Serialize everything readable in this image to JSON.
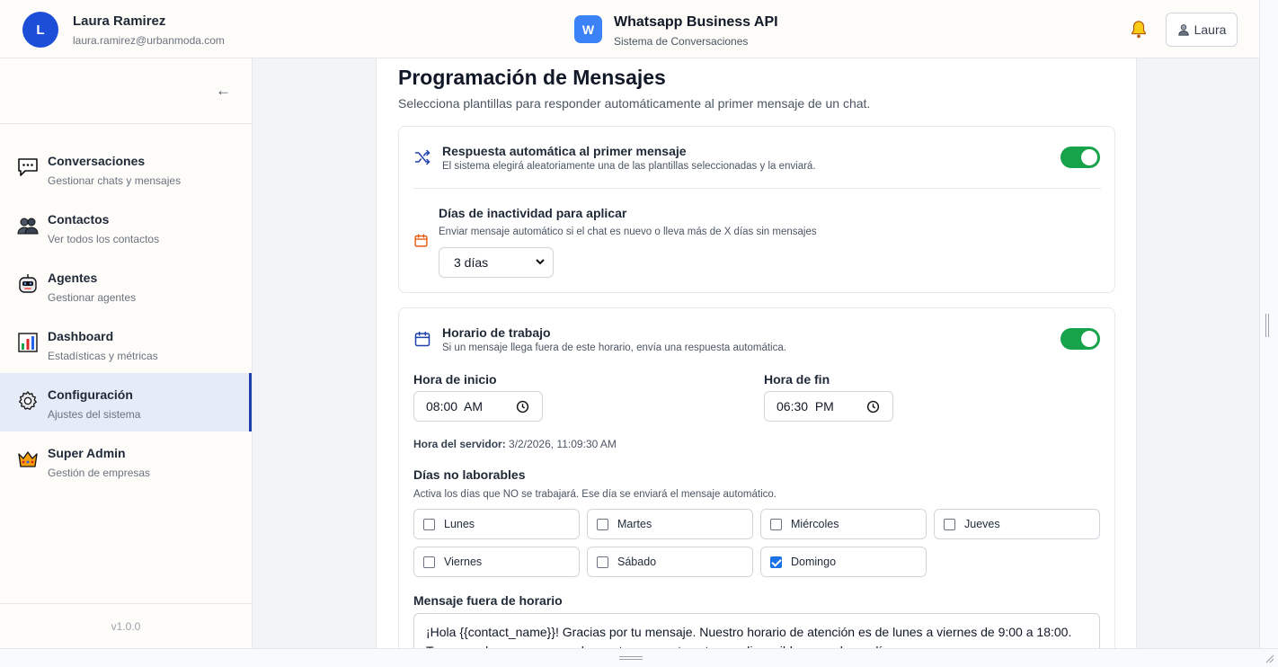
{
  "header": {
    "avatar_letter": "L",
    "user_name": "Laura Ramirez",
    "user_email": "laura.ramirez@urbanmoda.com",
    "app_logo_letter": "W",
    "app_title": "Whatsapp Business API",
    "app_subtitle": "Sistema de Conversaciones",
    "user_button_label": "Laura"
  },
  "sidebar": {
    "collapse_label": "←",
    "items": [
      {
        "title": "Conversaciones",
        "subtitle": "Gestionar chats y mensajes",
        "icon": "speech-bubble-icon"
      },
      {
        "title": "Contactos",
        "subtitle": "Ver todos los contactos",
        "icon": "people-icon"
      },
      {
        "title": "Agentes",
        "subtitle": "Gestionar agentes",
        "icon": "robot-icon"
      },
      {
        "title": "Dashboard",
        "subtitle": "Estadísticas y métricas",
        "icon": "bar-chart-icon"
      },
      {
        "title": "Configuración",
        "subtitle": "Ajustes del sistema",
        "icon": "gear-icon",
        "active": true
      },
      {
        "title": "Super Admin",
        "subtitle": "Gestión de empresas",
        "icon": "crown-icon"
      }
    ],
    "version": "v1.0.0"
  },
  "main": {
    "title": "Programación de Mensajes",
    "description": "Selecciona plantillas para responder automáticamente al primer mensaje de un chat.",
    "auto_reply": {
      "title": "Respuesta automática al primer mensaje",
      "subtitle": "El sistema elegirá aleatoriamente una de las plantillas seleccionadas y la enviará.",
      "enabled": true,
      "inactivity_title": "Días de inactividad para aplicar",
      "inactivity_subtitle": "Enviar mensaje automático si el chat es nuevo o lleva más de X días sin mensajes",
      "inactivity_value": "3 días"
    },
    "work_hours": {
      "title": "Horario de trabajo",
      "subtitle": "Si un mensaje llega fuera de este horario, envía una respuesta automática.",
      "enabled": true,
      "start_label": "Hora de inicio",
      "start_value": "08:00  AM",
      "end_label": "Hora de fin",
      "end_value": "06:30  PM",
      "server_time_label": "Hora del servidor:",
      "server_time_value": "3/2/2026, 11:09:30 AM",
      "non_working_title": "Días no laborables",
      "non_working_subtitle": "Activa los días que NO se trabajará. Ese día se enviará el mensaje automático.",
      "days": [
        {
          "label": "Lunes",
          "checked": false
        },
        {
          "label": "Martes",
          "checked": false
        },
        {
          "label": "Miércoles",
          "checked": false
        },
        {
          "label": "Jueves",
          "checked": false
        },
        {
          "label": "Viernes",
          "checked": false
        },
        {
          "label": "Sábado",
          "checked": false
        },
        {
          "label": "Domingo",
          "checked": true
        }
      ],
      "off_hours_label": "Mensaje fuera de horario",
      "off_hours_message": "¡Hola {{contact_name}}! Gracias por tu mensaje. Nuestro horario de atención es de lunes a viernes de 9:00 a 18:00. Te responderemos con mucho gusto en cuanto estemos disponibles, muy buen día."
    }
  },
  "colors": {
    "accent": "#1d4ed8",
    "toggle_on": "#16a34a",
    "active_nav_bg": "#e5ecf8"
  }
}
